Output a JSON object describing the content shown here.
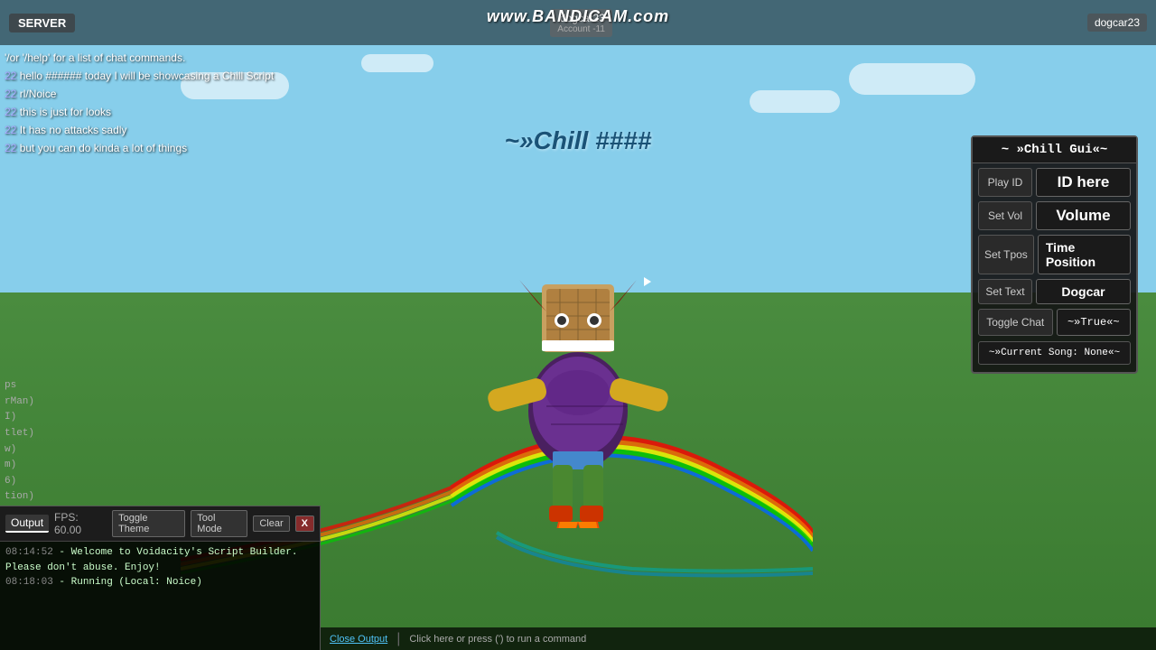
{
  "topbar": {
    "server_label": "SERVER",
    "watermark": "www.BANDICAM.com",
    "account_name": "dogcar23",
    "account_sub": "Account -11",
    "account_display": "dogcar23"
  },
  "chat": {
    "lines": [
      {
        "prefix": "",
        "text": "'/or '/help' for a list of chat commands.",
        "color": "white"
      },
      {
        "prefix": "22",
        "text": "hello ###### today I will be showcasing a Chill Script",
        "color": "white"
      },
      {
        "prefix": "22",
        "text": "rl/Noice",
        "color": "white"
      },
      {
        "prefix": "22",
        "text": "this is just for looks",
        "color": "white"
      },
      {
        "prefix": "22",
        "text": "It has no attacks sadly",
        "color": "white"
      },
      {
        "prefix": "22",
        "text": "but you can do kinda a lot of things",
        "color": "white"
      }
    ]
  },
  "floating_title": "~»Chill ####",
  "gui": {
    "title": "~ »Chill Gui«~",
    "play_id_label": "Play ID",
    "play_id_value": "ID here",
    "set_vol_label": "Set Vol",
    "set_vol_value": "Volume",
    "set_tpos_label": "Set Tpos",
    "set_tpos_value": "Time Position",
    "set_text_label": "Set Text",
    "set_text_value": "Dogcar",
    "toggle_chat_label": "Toggle Chat",
    "toggle_chat_value": "~»True«~",
    "current_song": "~»Current Song: None«~"
  },
  "output": {
    "tab_label": "Output",
    "fps_label": "FPS: 60.00",
    "toggle_theme_label": "Toggle Theme",
    "tool_mode_label": "Tool Mode",
    "clear_label": "Clear",
    "close_label": "X",
    "lines": [
      {
        "timestamp": "08:14:52",
        "text": "- Welcome to Voidacity's Script Builder. Please don't abuse. Enjoy!"
      },
      {
        "timestamp": "08:18:03",
        "text": "- Running (Local: Noice)"
      }
    ]
  },
  "bottom_bar": {
    "close_output_label": "Close Output",
    "click_label": "Click here or press (') to run a command"
  },
  "left_labels": {
    "items": [
      "ps",
      "rMan)",
      "I)",
      "tlet)",
      "w)",
      "m)",
      "6)",
      "tion)"
    ]
  }
}
